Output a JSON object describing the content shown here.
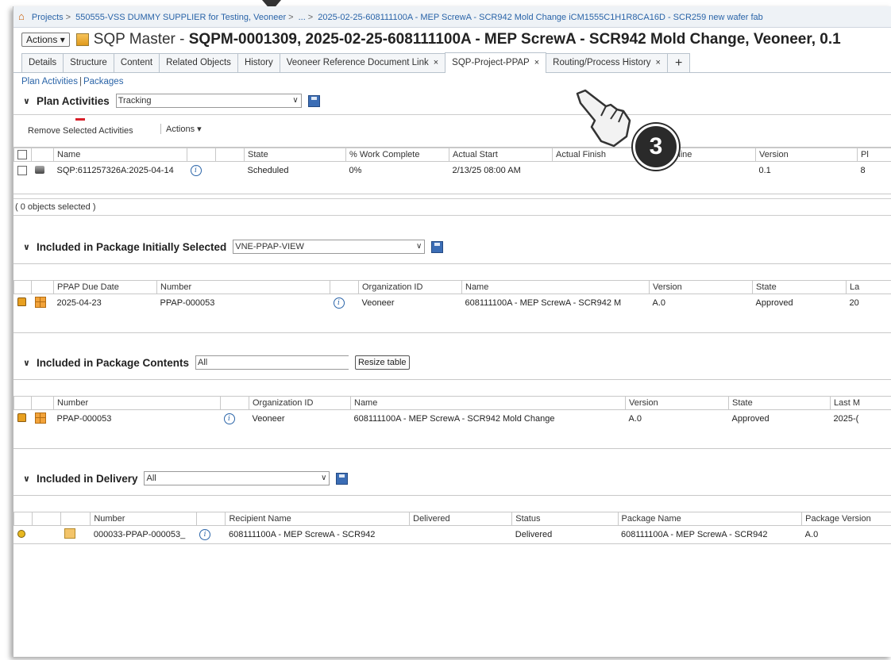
{
  "breadcrumb": {
    "parts": [
      "Projects",
      "550555-VSS DUMMY SUPPLIER for Testing, Veoneer",
      "...",
      "2025-02-25-608111100A - MEP ScrewA - SCR942 Mold Change iCM1555C1H1R8CA16D - SCR259 new wafer fab"
    ]
  },
  "header": {
    "actions_label": "Actions",
    "title_prefix": "SQP Master - ",
    "title_bold": "SQPM-0001309, 2025-02-25-608111100A -  MEP ScrewA - SCR942 Mold Change, Veoneer, 0.1"
  },
  "tabs": [
    {
      "label": "Details"
    },
    {
      "label": "Structure"
    },
    {
      "label": "Content"
    },
    {
      "label": "Related Objects"
    },
    {
      "label": "History"
    },
    {
      "label": "Veoneer Reference Document Link",
      "close": "×"
    },
    {
      "label": "SQP-Project-PPAP",
      "close": "×"
    },
    {
      "label": "Routing/Process History",
      "close": "×"
    },
    {
      "label": "+"
    }
  ],
  "sublinks": {
    "plan_activities": "Plan Activities",
    "sep": "|",
    "packages": "Packages"
  },
  "plan_activities": {
    "title": "Plan Activities",
    "view": "Tracking",
    "remove_label": "Remove Selected Activities",
    "actions_label": "Actions",
    "columns": [
      "Name",
      "State",
      "% Work Complete",
      "Actual Start",
      "Actual Finish",
      "Deadline",
      "Version",
      "Pl"
    ],
    "row": {
      "name": "SQP:611257326A:2025-04-14",
      "state": "Scheduled",
      "work_complete": "0%",
      "actual_start": "2/13/25 08:00 AM",
      "actual_finish": "",
      "deadline": "",
      "version": "0.1",
      "pl": "8"
    },
    "selected_status": "( 0 objects selected )"
  },
  "package_initial": {
    "title": "Included in Package Initially Selected",
    "view": "VNE-PPAP-VIEW",
    "columns": [
      "PPAP Due Date",
      "Number",
      "Organization ID",
      "Name",
      "Version",
      "State",
      "La"
    ],
    "row": {
      "due_date": "2025-04-23",
      "number": "PPAP-000053",
      "org": "Veoneer",
      "name": "608111100A -  MEP ScrewA - SCR942 M",
      "version": "A.0",
      "state": "Approved",
      "last": "20"
    }
  },
  "package_contents": {
    "title": "Included in Package Contents",
    "view": "All",
    "resize_label": "Resize table",
    "columns": [
      "Number",
      "Organization ID",
      "Name",
      "Version",
      "State",
      "Last M"
    ],
    "row": {
      "number": "PPAP-000053",
      "org": "Veoneer",
      "name": "608111100A -  MEP ScrewA - SCR942 Mold Change",
      "version": "A.0",
      "state": "Approved",
      "last": "2025-("
    }
  },
  "delivery": {
    "title": "Included in Delivery",
    "view": "All",
    "columns": [
      "Number",
      "Recipient Name",
      "Delivered",
      "Status",
      "Package Name",
      "Package Version"
    ],
    "row": {
      "number": "000033-PPAP-000053_",
      "recipient": "608111100A -  MEP ScrewA - SCR942",
      "delivered": "",
      "status": "Delivered",
      "package_name": "608111100A -  MEP ScrewA - SCR942",
      "package_version": "A.0"
    }
  },
  "annotation": {
    "step": "3"
  }
}
